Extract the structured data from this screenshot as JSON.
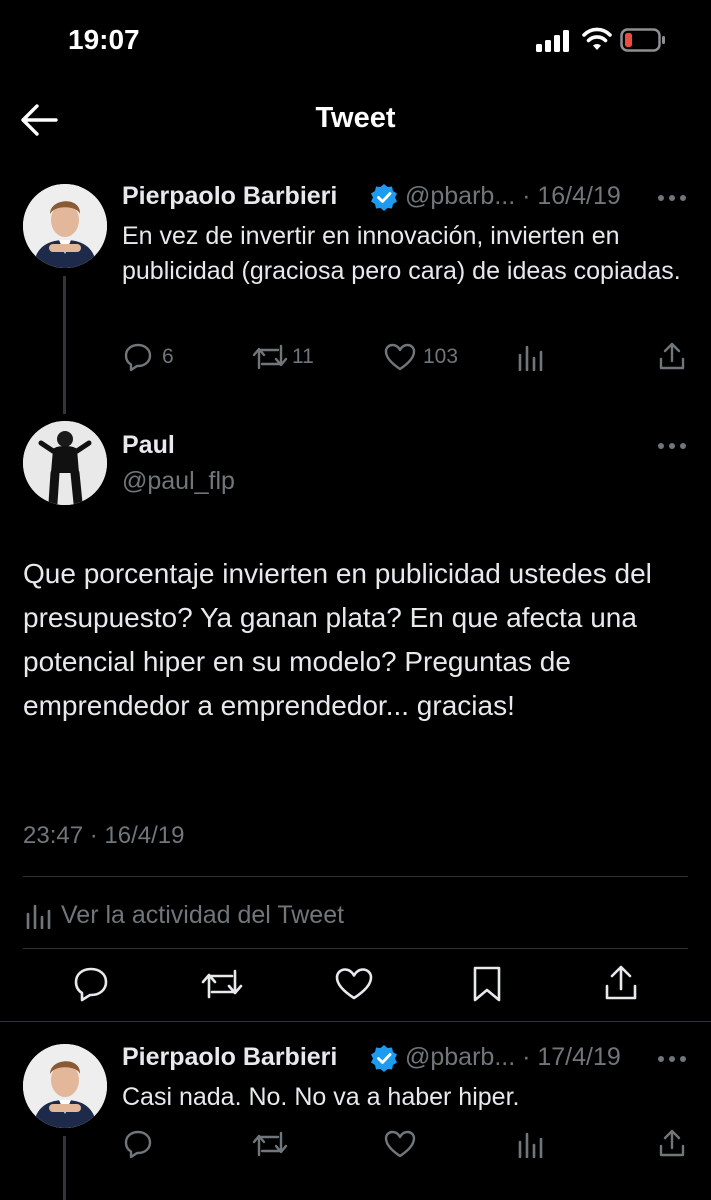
{
  "status_bar": {
    "time": "19:07"
  },
  "header": {
    "title": "Tweet"
  },
  "parent_tweet": {
    "name": "Pierpaolo Barbieri",
    "handle_date": "@pbarb... · 16/4/19",
    "text": "En vez de invertir en innovación, invierten en publicidad (graciosa pero cara) de ideas copiadas.",
    "replies": "6",
    "retweets": "11",
    "likes": "103"
  },
  "main_tweet": {
    "name": "Paul",
    "handle": "@paul_flp",
    "text": "Que porcentaje invierten en publicidad ustedes del presupuesto? Ya ganan plata? En que afecta una potencial hiper en su modelo? Preguntas de emprendedor a emprendedor... gracias!",
    "timestamp": "23:47 · 16/4/19",
    "activity_label": "Ver la actividad del Tweet"
  },
  "reply_tweet": {
    "name": "Pierpaolo Barbieri",
    "handle_date": "@pbarb... · 17/4/19",
    "text": "Casi nada. No. No va a haber hiper."
  },
  "colors": {
    "background": "#000000",
    "verified": "#1d9bf0",
    "muted": "#71767b",
    "battery_low": "#eb4d3d"
  }
}
